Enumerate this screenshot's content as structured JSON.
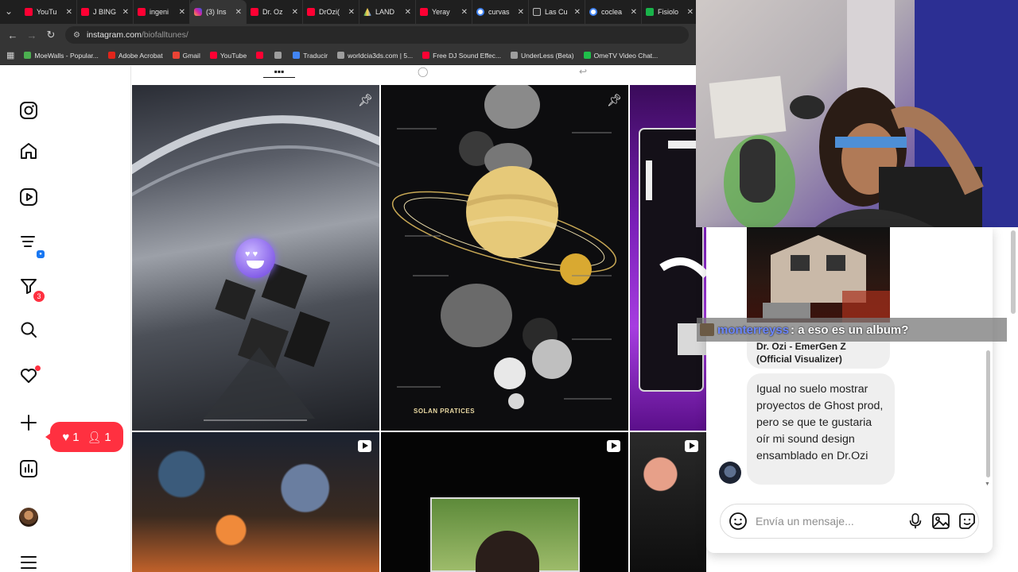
{
  "browser": {
    "tabs": [
      {
        "label": "YouTu",
        "icon": "youtube-icon",
        "active": false
      },
      {
        "label": "J BING",
        "icon": "youtube-icon",
        "active": false
      },
      {
        "label": "ingeni",
        "icon": "youtube-icon",
        "active": false
      },
      {
        "label": "(3) Ins",
        "icon": "instagram-icon",
        "active": true
      },
      {
        "label": "Dr. Oz",
        "icon": "youtube-icon",
        "active": false
      },
      {
        "label": "DrOzi(",
        "icon": "youtube-icon",
        "active": false
      },
      {
        "label": "LAND",
        "icon": "google-drive-icon",
        "active": false
      },
      {
        "label": "Yeray",
        "icon": "youtube-icon",
        "active": false
      },
      {
        "label": "curvas",
        "icon": "google-icon",
        "active": false
      },
      {
        "label": "Las Cu",
        "icon": "bookmark-icon",
        "active": false
      },
      {
        "label": "coclea",
        "icon": "google-icon",
        "active": false
      },
      {
        "label": "Fisiolo",
        "icon": "gb-icon",
        "active": false
      }
    ],
    "url_host": "instagram.com",
    "url_path": "/biofalltunes/",
    "bookmarks": [
      {
        "label": "MoeWalls - Popular...",
        "color": "#4caf50"
      },
      {
        "label": "Adobe Acrobat",
        "color": "#e1251b"
      },
      {
        "label": "Gmail",
        "color": "#ea4335"
      },
      {
        "label": "YouTube",
        "color": "#ff0033"
      },
      {
        "label": "",
        "color": "#ff0033"
      },
      {
        "label": "",
        "color": "#9e9e9e"
      },
      {
        "label": "Traducir",
        "color": "#4285f4"
      },
      {
        "label": "worldcia3ds.com | 5...",
        "color": "#9e9e9e"
      },
      {
        "label": "Free DJ Sound Effec...",
        "color": "#ff0033"
      },
      {
        "label": "UnderLess (Beta)",
        "color": "#9e9e9e"
      },
      {
        "label": "OmeTV Video Chat...",
        "color": "#1fbf4a"
      }
    ]
  },
  "instagram": {
    "notifications": {
      "likes": "1",
      "follows": "1"
    },
    "filter_badge": "3",
    "posts": [
      {
        "type": "pinned"
      },
      {
        "type": "pinned",
        "caption": "SOLAN PRATICES"
      },
      {
        "type": "pinned"
      },
      {
        "type": "reel"
      },
      {
        "type": "reel"
      },
      {
        "type": "reel"
      }
    ]
  },
  "dm": {
    "overlay_user": "monterreyss",
    "overlay_message": ": a eso es un album?",
    "shared_title": "Dr. Ozi - EmerGen Z (Official Visualizer)",
    "message": "Igual no suelo mostrar proyectos de Ghost prod, pero se que te gustaria oír mi sound design ensamblado en Dr.Ozi",
    "input_placeholder": "Envía un mensaje..."
  },
  "colors": {
    "accent": "#ff3040",
    "chrome_bg": "#1f1f1f",
    "toolbar_bg": "#353535"
  }
}
